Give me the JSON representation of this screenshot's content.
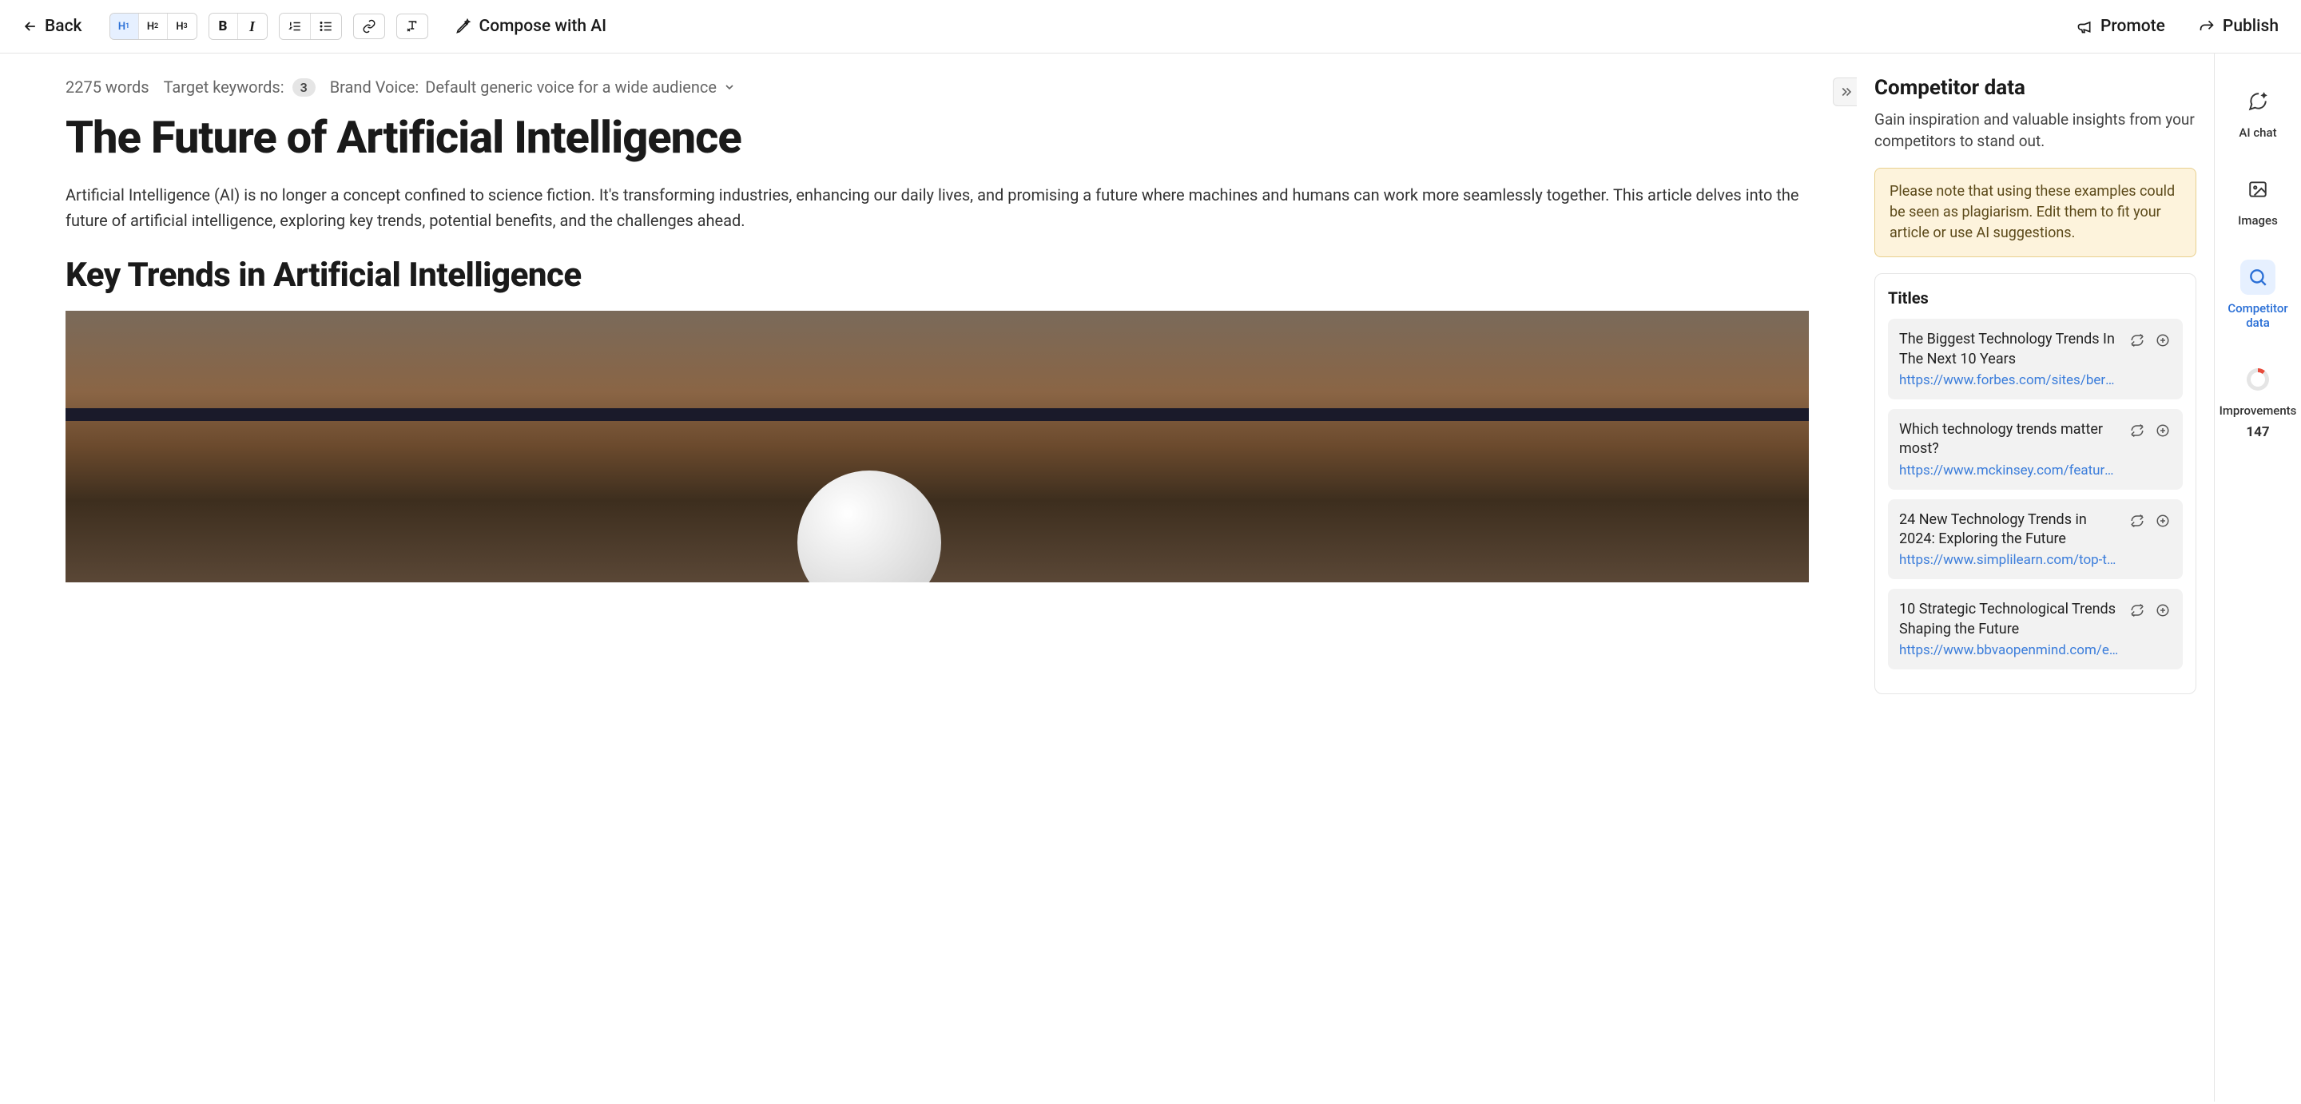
{
  "topbar": {
    "back": "Back",
    "compose": "Compose with AI",
    "promote": "Promote",
    "publish": "Publish"
  },
  "meta": {
    "word_count": "2275 words",
    "target_kw_label": "Target keywords:",
    "target_kw_count": "3",
    "brand_voice_label": "Brand Voice:",
    "brand_voice_value": "Default generic voice for a wide audience"
  },
  "article": {
    "title": "The Future of Artificial Intelligence",
    "intro": "Artificial Intelligence (AI) is no longer a concept confined to science fiction. It's transforming industries, enhancing our daily lives, and promising a future where machines and humans can work more seamlessly together. This article delves into the future of artificial intelligence, exploring key trends, potential benefits, and the challenges ahead.",
    "h2": "Key Trends in Artificial Intelligence"
  },
  "panel": {
    "title": "Competitor data",
    "subtitle": "Gain inspiration and valuable insights from your competitors to stand out.",
    "warning": "Please note that using these examples could be seen as plagiarism. Edit them to fit your article or use AI suggestions.",
    "section_heading": "Titles",
    "titles": [
      {
        "name": "The Biggest Technology Trends In The Next 10 Years",
        "url": "https://www.forbes.com/sites/bernar..."
      },
      {
        "name": "Which technology trends matter most?",
        "url": "https://www.mckinsey.com/featured-i..."
      },
      {
        "name": "24 New Technology Trends in 2024: Exploring the Future",
        "url": "https://www.simplilearn.com/top-tech..."
      },
      {
        "name": "10 Strategic Technological Trends Shaping the Future",
        "url": "https://www.bbvaopenmind.com/en/t..."
      }
    ]
  },
  "rail": {
    "ai_chat": "AI chat",
    "images": "Images",
    "competitor": "Competitor data",
    "improvements": "Improvements",
    "improvements_count": "147"
  }
}
